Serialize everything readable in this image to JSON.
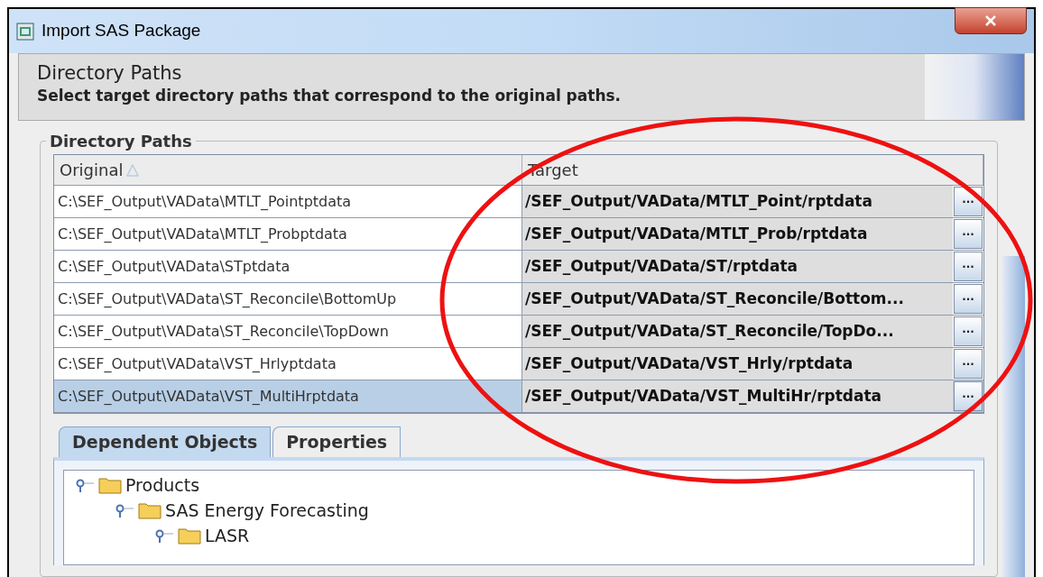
{
  "window": {
    "title": "Import SAS Package"
  },
  "header": {
    "title": "Directory Paths",
    "subtitle": "Select target directory paths that correspond to the original paths."
  },
  "group": {
    "title": "Directory Paths"
  },
  "table": {
    "columns": [
      {
        "label": "Original",
        "sorted": true
      },
      {
        "label": "Target",
        "sorted": false
      }
    ],
    "rows": [
      {
        "original": "C:\\SEF_Output\\VAData\\MTLT_Pointptdata",
        "target": "/SEF_Output/VAData/MTLT_Point/rptdata",
        "browse": "···",
        "selected": false
      },
      {
        "original": "C:\\SEF_Output\\VAData\\MTLT_Probptdata",
        "target": "/SEF_Output/VAData/MTLT_Prob/rptdata",
        "browse": "···",
        "selected": false
      },
      {
        "original": "C:\\SEF_Output\\VAData\\STptdata",
        "target": "/SEF_Output/VAData/ST/rptdata",
        "browse": "···",
        "selected": false
      },
      {
        "original": "C:\\SEF_Output\\VAData\\ST_Reconcile\\BottomUp",
        "target": "/SEF_Output/VAData/ST_Reconcile/Bottom...",
        "browse": "···",
        "selected": false
      },
      {
        "original": "C:\\SEF_Output\\VAData\\ST_Reconcile\\TopDown",
        "target": "/SEF_Output/VAData/ST_Reconcile/TopDo...",
        "browse": "···",
        "selected": false
      },
      {
        "original": "C:\\SEF_Output\\VAData\\VST_Hrlyptdata",
        "target": "/SEF_Output/VAData/VST_Hrly/rptdata",
        "browse": "···",
        "selected": false
      },
      {
        "original": "C:\\SEF_Output\\VAData\\VST_MultiHrptdata",
        "target": "/SEF_Output/VAData/VST_MultiHr/rptdata",
        "browse": "···",
        "selected": true
      }
    ]
  },
  "tabs": [
    {
      "label": "Dependent Objects",
      "selected": true
    },
    {
      "label": "Properties",
      "selected": false
    }
  ],
  "tree": [
    {
      "label": "Products",
      "expanded": true,
      "children": [
        {
          "label": "SAS Energy Forecasting",
          "expanded": true,
          "children": [
            {
              "label": "LASR",
              "expanded": true
            }
          ]
        }
      ]
    }
  ]
}
